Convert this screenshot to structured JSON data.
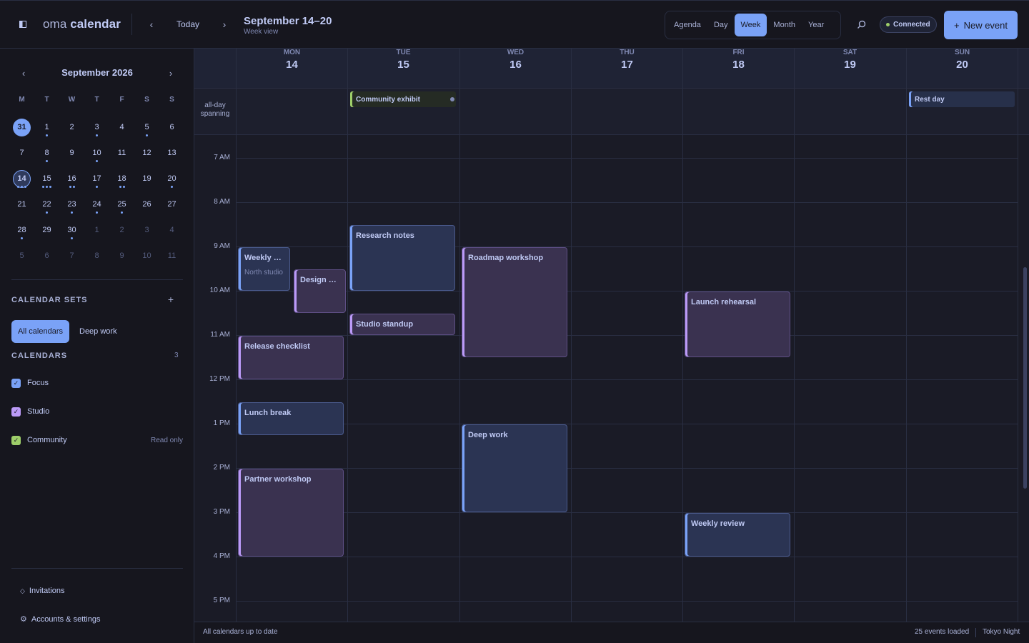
{
  "app": {
    "brand_prefix": "oma",
    "brand_name": "calendar",
    "sidebar_toggle_icon": "sidebar-toggle-icon"
  },
  "header": {
    "prev_label": "‹",
    "today_label": "Today",
    "next_label": "›",
    "title": "September 14–20",
    "subtitle": "Week view",
    "views": [
      "Agenda",
      "Day",
      "Week",
      "Month",
      "Year"
    ],
    "active_view": "Week",
    "search_icon": "search-icon",
    "status_label": "Connected",
    "status_color": "#9ece6a",
    "new_event_label": "New event",
    "accent_color": "#7aa2f7"
  },
  "mini_calendar": {
    "title": "September 2026",
    "prev_label": "‹",
    "next_label": "›",
    "weekdays": [
      "M",
      "T",
      "W",
      "T",
      "F",
      "S",
      "S"
    ],
    "weeks": [
      [
        {
          "d": "31",
          "state": "selected",
          "dots": 0
        },
        {
          "d": "1",
          "dots": 1
        },
        {
          "d": "2",
          "dots": 0
        },
        {
          "d": "3",
          "dots": 1
        },
        {
          "d": "4",
          "dots": 0
        },
        {
          "d": "5",
          "dots": 1
        },
        {
          "d": "6",
          "dots": 0
        }
      ],
      [
        {
          "d": "7",
          "dots": 0
        },
        {
          "d": "8",
          "dots": 1
        },
        {
          "d": "9",
          "dots": 0
        },
        {
          "d": "10",
          "dots": 1
        },
        {
          "d": "11",
          "dots": 0
        },
        {
          "d": "12",
          "dots": 0
        },
        {
          "d": "13",
          "dots": 0
        }
      ],
      [
        {
          "d": "14",
          "state": "current",
          "dots": 3
        },
        {
          "d": "15",
          "dots": 3
        },
        {
          "d": "16",
          "dots": 2
        },
        {
          "d": "17",
          "dots": 1
        },
        {
          "d": "18",
          "dots": 2
        },
        {
          "d": "19",
          "dots": 0
        },
        {
          "d": "20",
          "dots": 1
        }
      ],
      [
        {
          "d": "21",
          "dots": 0
        },
        {
          "d": "22",
          "dots": 1
        },
        {
          "d": "23",
          "dots": 1
        },
        {
          "d": "24",
          "dots": 1
        },
        {
          "d": "25",
          "dots": 1
        },
        {
          "d": "26",
          "dots": 0
        },
        {
          "d": "27",
          "dots": 0
        }
      ],
      [
        {
          "d": "28",
          "dots": 1
        },
        {
          "d": "29",
          "dots": 0
        },
        {
          "d": "30",
          "dots": 1
        },
        {
          "d": "1",
          "state": "muted",
          "dots": 0
        },
        {
          "d": "2",
          "state": "muted",
          "dots": 0
        },
        {
          "d": "3",
          "state": "muted",
          "dots": 0
        },
        {
          "d": "4",
          "state": "muted",
          "dots": 0
        }
      ],
      [
        {
          "d": "5",
          "state": "muted",
          "dots": 0
        },
        {
          "d": "6",
          "state": "muted",
          "dots": 0
        },
        {
          "d": "7",
          "state": "muted",
          "dots": 0
        },
        {
          "d": "8",
          "state": "muted",
          "dots": 0
        },
        {
          "d": "9",
          "state": "muted",
          "dots": 0
        },
        {
          "d": "10",
          "state": "muted",
          "dots": 0
        },
        {
          "d": "11",
          "state": "muted",
          "dots": 0
        }
      ]
    ]
  },
  "calendar_sets": {
    "heading": "CALENDAR SETS",
    "add_label": "+",
    "sets": [
      "All calendars",
      "Deep work"
    ],
    "active_set": "All calendars"
  },
  "calendars": {
    "heading": "CALENDARS",
    "count": "3",
    "items": [
      {
        "name": "Focus",
        "color": "#7aa2f7",
        "checked": true,
        "note": ""
      },
      {
        "name": "Studio",
        "color": "#bb9af7",
        "checked": true,
        "note": ""
      },
      {
        "name": "Community",
        "color": "#9ece6a",
        "checked": true,
        "note": "Read only"
      }
    ]
  },
  "sidebar_footer": {
    "invitations_label": "Invitations",
    "invitations_icon": "diamond-icon",
    "settings_label": "Accounts & settings",
    "settings_icon": "gear-icon"
  },
  "week": {
    "days": [
      {
        "dow": "MON",
        "num": "14"
      },
      {
        "dow": "TUE",
        "num": "15"
      },
      {
        "dow": "WED",
        "num": "16"
      },
      {
        "dow": "THU",
        "num": "17"
      },
      {
        "dow": "FRI",
        "num": "18"
      },
      {
        "dow": "SAT",
        "num": "19"
      },
      {
        "dow": "SUN",
        "num": "20"
      }
    ],
    "allday_label_line1": "all-day",
    "allday_label_line2": "spanning",
    "hours": [
      "7 AM",
      "8 AM",
      "9 AM",
      "10 AM",
      "11 AM",
      "12 PM",
      "1 PM",
      "2 PM",
      "3 PM",
      "4 PM",
      "5 PM"
    ],
    "allday_events": [
      {
        "title": "Community exhibit",
        "day": 1,
        "calendar": "Community",
        "has_more_dot": true
      },
      {
        "title": "Rest day",
        "day": 6,
        "calendar": "Focus",
        "has_more_dot": false
      }
    ],
    "events": [
      {
        "title": "Weekly …",
        "subtitle": "North studio",
        "day": 0,
        "start": "9:00",
        "end": "10:00",
        "calendar": "Focus",
        "lane": 0,
        "lanes": 2
      },
      {
        "title": "Design …",
        "subtitle": "",
        "day": 0,
        "start": "9:30",
        "end": "10:30",
        "calendar": "Studio",
        "lane": 1,
        "lanes": 2
      },
      {
        "title": "Release checklist",
        "subtitle": "",
        "day": 0,
        "start": "11:00",
        "end": "12:00",
        "calendar": "Studio",
        "lane": 0,
        "lanes": 1
      },
      {
        "title": "Lunch break",
        "subtitle": "",
        "day": 0,
        "start": "12:30",
        "end": "13:15",
        "calendar": "Focus",
        "lane": 0,
        "lanes": 1
      },
      {
        "title": "Partner workshop",
        "subtitle": "",
        "day": 0,
        "start": "14:00",
        "end": "16:00",
        "calendar": "Studio",
        "lane": 0,
        "lanes": 1
      },
      {
        "title": "Research notes",
        "subtitle": "",
        "day": 1,
        "start": "8:30",
        "end": "10:00",
        "calendar": "Focus",
        "lane": 0,
        "lanes": 1
      },
      {
        "title": "Studio standup",
        "subtitle": "",
        "day": 1,
        "start": "10:30",
        "end": "11:00",
        "calendar": "Studio",
        "lane": 0,
        "lanes": 1
      },
      {
        "title": "Roadmap workshop",
        "subtitle": "",
        "day": 2,
        "start": "9:00",
        "end": "11:30",
        "calendar": "Studio",
        "lane": 0,
        "lanes": 1
      },
      {
        "title": "Deep work",
        "subtitle": "",
        "day": 2,
        "start": "13:00",
        "end": "15:00",
        "calendar": "Focus",
        "lane": 0,
        "lanes": 1
      },
      {
        "title": "Launch rehearsal",
        "subtitle": "",
        "day": 4,
        "start": "10:00",
        "end": "11:30",
        "calendar": "Studio",
        "lane": 0,
        "lanes": 1
      },
      {
        "title": "Weekly review",
        "subtitle": "",
        "day": 4,
        "start": "15:00",
        "end": "16:00",
        "calendar": "Focus",
        "lane": 0,
        "lanes": 1
      }
    ]
  },
  "footer": {
    "sync_status": "All calendars up to date",
    "events_loaded": "25 events loaded",
    "theme": "Tokyo Night"
  }
}
